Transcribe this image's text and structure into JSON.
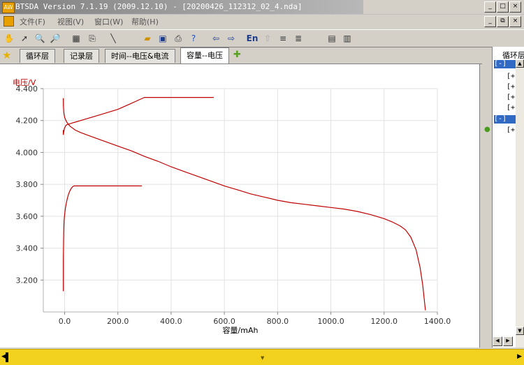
{
  "window": {
    "title": "BTSDA Version 7.1.19 (2009.12.10)   - [20200426_112312_02_4.nda]",
    "app_icon": "btsda-app-icon",
    "controls": [
      "_",
      "□",
      "×"
    ],
    "doc_controls": [
      "_",
      "⧉",
      "×"
    ]
  },
  "menu": {
    "items": [
      {
        "label": "文件(F)"
      },
      {
        "label": "视图(V)"
      },
      {
        "label": "窗口(W)"
      },
      {
        "label": "帮助(H)"
      }
    ]
  },
  "toolbar": {
    "lang_label": "En",
    "icons": [
      "hand-icon",
      "cursor-icon",
      "zoom-in-icon",
      "zoom-out-icon",
      "table-icon",
      "export-icon",
      "line-icon",
      "open-folder-icon",
      "save-icon",
      "print-icon",
      "help-icon",
      "back-icon",
      "forward-icon",
      "language-icon",
      "up-arrow-icon",
      "sort-icon",
      "sort-desc-icon",
      "grid-icon",
      "layout-icon"
    ]
  },
  "tabs": {
    "items": [
      {
        "label": "循环层"
      },
      {
        "label": "记录层"
      },
      {
        "label": "时间--电压&电流"
      },
      {
        "label": "容量--电压"
      }
    ],
    "active_index": 3
  },
  "right_panel": {
    "title": "循环层",
    "rows": [
      "[-]",
      "[+",
      "[+",
      "[+",
      "[+",
      "[-]",
      "[+"
    ]
  },
  "chart_data": {
    "type": "line",
    "xlabel": "容量/mAh",
    "ylabel": "电压/V",
    "xlim": [
      -80,
      1400
    ],
    "ylim": [
      3.0,
      4.4
    ],
    "x_ticks": [
      0,
      200,
      400,
      600,
      800,
      1000,
      1200,
      1400
    ],
    "x_tick_labels": [
      "0.0",
      "200.0",
      "400.0",
      "600.0",
      "800.0",
      "1000.0",
      "1200.0",
      "1400.0"
    ],
    "y_ticks": [
      3.2,
      3.4,
      3.6,
      3.8,
      4.0,
      4.2,
      4.4
    ],
    "y_tick_labels": [
      "3.200",
      "3.400",
      "3.600",
      "3.800",
      "4.000",
      "4.200",
      "4.400"
    ],
    "grid": true,
    "line_color": "#c00000",
    "series": [
      {
        "x": [
          -5,
          -5,
          -3,
          -1,
          2,
          5,
          10,
          20,
          30,
          40,
          60,
          90,
          120,
          160,
          200,
          240,
          280,
          300,
          350,
          400,
          450,
          500,
          560
        ],
        "y": [
          4.14,
          4.11,
          4.13,
          4.15,
          4.16,
          4.17,
          4.175,
          4.18,
          4.185,
          4.19,
          4.2,
          4.215,
          4.23,
          4.25,
          4.27,
          4.3,
          4.33,
          4.345,
          4.345,
          4.345,
          4.345,
          4.345,
          4.345
        ]
      },
      {
        "x": [
          -5,
          -5,
          -3,
          0,
          5,
          10,
          20,
          40,
          60,
          100,
          150,
          200,
          250,
          300,
          350,
          400,
          450,
          500,
          550,
          600,
          650,
          700,
          750,
          800,
          850,
          900,
          950,
          1000,
          1050,
          1100,
          1150,
          1200,
          1230,
          1260,
          1280,
          1300,
          1320,
          1335,
          1345,
          1355
        ],
        "y": [
          4.34,
          4.3,
          4.25,
          4.22,
          4.2,
          4.185,
          4.165,
          4.14,
          4.125,
          4.1,
          4.07,
          4.04,
          4.01,
          3.975,
          3.945,
          3.91,
          3.88,
          3.85,
          3.82,
          3.79,
          3.765,
          3.74,
          3.72,
          3.7,
          3.685,
          3.675,
          3.665,
          3.655,
          3.645,
          3.63,
          3.61,
          3.585,
          3.565,
          3.54,
          3.515,
          3.47,
          3.39,
          3.28,
          3.17,
          3.01
        ]
      },
      {
        "x": [
          -5,
          -5,
          -4,
          -3,
          -2,
          0,
          3,
          6,
          10,
          15,
          20,
          25,
          30,
          35,
          40,
          80,
          150,
          220,
          290
        ],
        "y": [
          3.13,
          3.33,
          3.45,
          3.52,
          3.57,
          3.61,
          3.65,
          3.68,
          3.71,
          3.74,
          3.76,
          3.775,
          3.785,
          3.79,
          3.79,
          3.79,
          3.79,
          3.79,
          3.79
        ]
      }
    ]
  }
}
